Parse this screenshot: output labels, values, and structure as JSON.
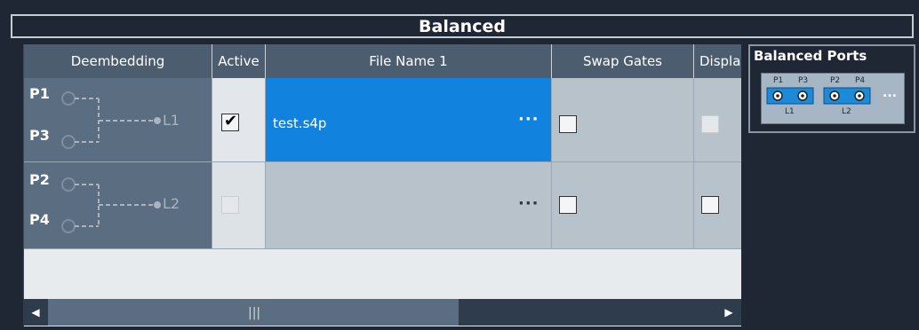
{
  "title": "Balanced",
  "columns": {
    "deembedding": "Deembedding",
    "active": "Active",
    "file_name": "File Name 1",
    "swap_gates": "Swap Gates",
    "display": "Displa"
  },
  "rows": [
    {
      "port_a": "P1",
      "port_b": "P3",
      "logical": "L1",
      "active": true,
      "file": "test.s4p",
      "file_button": "···",
      "swap": false,
      "display": false
    },
    {
      "port_a": "P2",
      "port_b": "P4",
      "logical": "L2",
      "active": false,
      "file": "",
      "file_button": "···",
      "swap": false,
      "display": false
    }
  ],
  "scrollbar": {
    "left_arrow": "◀",
    "right_arrow": "▶",
    "grip": "|||"
  },
  "balanced_ports": {
    "title": "Balanced Ports",
    "ports": [
      "P1",
      "P3",
      "P2",
      "P4"
    ],
    "logical": [
      "L1",
      "L2"
    ],
    "more": "..."
  },
  "colors": {
    "selected": "#1182dd",
    "header": "#4c5d6f",
    "background": "#1e2733"
  }
}
